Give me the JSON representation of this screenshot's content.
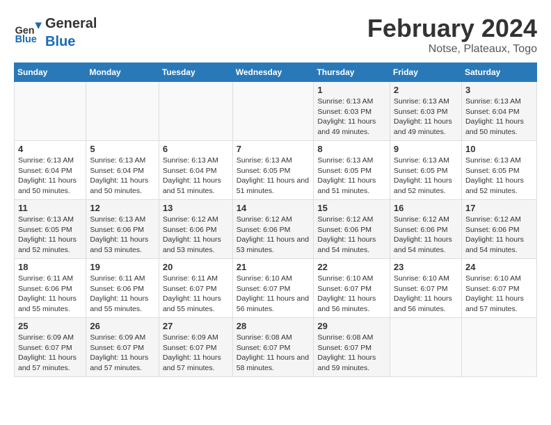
{
  "header": {
    "logo_general": "General",
    "logo_blue": "Blue",
    "title": "February 2024",
    "subtitle": "Notse, Plateaux, Togo"
  },
  "weekdays": [
    "Sunday",
    "Monday",
    "Tuesday",
    "Wednesday",
    "Thursday",
    "Friday",
    "Saturday"
  ],
  "weeks": [
    [
      {
        "day": "",
        "info": ""
      },
      {
        "day": "",
        "info": ""
      },
      {
        "day": "",
        "info": ""
      },
      {
        "day": "",
        "info": ""
      },
      {
        "day": "1",
        "info": "Sunrise: 6:13 AM\nSunset: 6:03 PM\nDaylight: 11 hours and 49 minutes."
      },
      {
        "day": "2",
        "info": "Sunrise: 6:13 AM\nSunset: 6:03 PM\nDaylight: 11 hours and 49 minutes."
      },
      {
        "day": "3",
        "info": "Sunrise: 6:13 AM\nSunset: 6:04 PM\nDaylight: 11 hours and 50 minutes."
      }
    ],
    [
      {
        "day": "4",
        "info": "Sunrise: 6:13 AM\nSunset: 6:04 PM\nDaylight: 11 hours and 50 minutes."
      },
      {
        "day": "5",
        "info": "Sunrise: 6:13 AM\nSunset: 6:04 PM\nDaylight: 11 hours and 50 minutes."
      },
      {
        "day": "6",
        "info": "Sunrise: 6:13 AM\nSunset: 6:04 PM\nDaylight: 11 hours and 51 minutes."
      },
      {
        "day": "7",
        "info": "Sunrise: 6:13 AM\nSunset: 6:05 PM\nDaylight: 11 hours and 51 minutes."
      },
      {
        "day": "8",
        "info": "Sunrise: 6:13 AM\nSunset: 6:05 PM\nDaylight: 11 hours and 51 minutes."
      },
      {
        "day": "9",
        "info": "Sunrise: 6:13 AM\nSunset: 6:05 PM\nDaylight: 11 hours and 52 minutes."
      },
      {
        "day": "10",
        "info": "Sunrise: 6:13 AM\nSunset: 6:05 PM\nDaylight: 11 hours and 52 minutes."
      }
    ],
    [
      {
        "day": "11",
        "info": "Sunrise: 6:13 AM\nSunset: 6:05 PM\nDaylight: 11 hours and 52 minutes."
      },
      {
        "day": "12",
        "info": "Sunrise: 6:13 AM\nSunset: 6:06 PM\nDaylight: 11 hours and 53 minutes."
      },
      {
        "day": "13",
        "info": "Sunrise: 6:12 AM\nSunset: 6:06 PM\nDaylight: 11 hours and 53 minutes."
      },
      {
        "day": "14",
        "info": "Sunrise: 6:12 AM\nSunset: 6:06 PM\nDaylight: 11 hours and 53 minutes."
      },
      {
        "day": "15",
        "info": "Sunrise: 6:12 AM\nSunset: 6:06 PM\nDaylight: 11 hours and 54 minutes."
      },
      {
        "day": "16",
        "info": "Sunrise: 6:12 AM\nSunset: 6:06 PM\nDaylight: 11 hours and 54 minutes."
      },
      {
        "day": "17",
        "info": "Sunrise: 6:12 AM\nSunset: 6:06 PM\nDaylight: 11 hours and 54 minutes."
      }
    ],
    [
      {
        "day": "18",
        "info": "Sunrise: 6:11 AM\nSunset: 6:06 PM\nDaylight: 11 hours and 55 minutes."
      },
      {
        "day": "19",
        "info": "Sunrise: 6:11 AM\nSunset: 6:06 PM\nDaylight: 11 hours and 55 minutes."
      },
      {
        "day": "20",
        "info": "Sunrise: 6:11 AM\nSunset: 6:07 PM\nDaylight: 11 hours and 55 minutes."
      },
      {
        "day": "21",
        "info": "Sunrise: 6:10 AM\nSunset: 6:07 PM\nDaylight: 11 hours and 56 minutes."
      },
      {
        "day": "22",
        "info": "Sunrise: 6:10 AM\nSunset: 6:07 PM\nDaylight: 11 hours and 56 minutes."
      },
      {
        "day": "23",
        "info": "Sunrise: 6:10 AM\nSunset: 6:07 PM\nDaylight: 11 hours and 56 minutes."
      },
      {
        "day": "24",
        "info": "Sunrise: 6:10 AM\nSunset: 6:07 PM\nDaylight: 11 hours and 57 minutes."
      }
    ],
    [
      {
        "day": "25",
        "info": "Sunrise: 6:09 AM\nSunset: 6:07 PM\nDaylight: 11 hours and 57 minutes."
      },
      {
        "day": "26",
        "info": "Sunrise: 6:09 AM\nSunset: 6:07 PM\nDaylight: 11 hours and 57 minutes."
      },
      {
        "day": "27",
        "info": "Sunrise: 6:09 AM\nSunset: 6:07 PM\nDaylight: 11 hours and 57 minutes."
      },
      {
        "day": "28",
        "info": "Sunrise: 6:08 AM\nSunset: 6:07 PM\nDaylight: 11 hours and 58 minutes."
      },
      {
        "day": "29",
        "info": "Sunrise: 6:08 AM\nSunset: 6:07 PM\nDaylight: 11 hours and 59 minutes."
      },
      {
        "day": "",
        "info": ""
      },
      {
        "day": "",
        "info": ""
      }
    ]
  ]
}
